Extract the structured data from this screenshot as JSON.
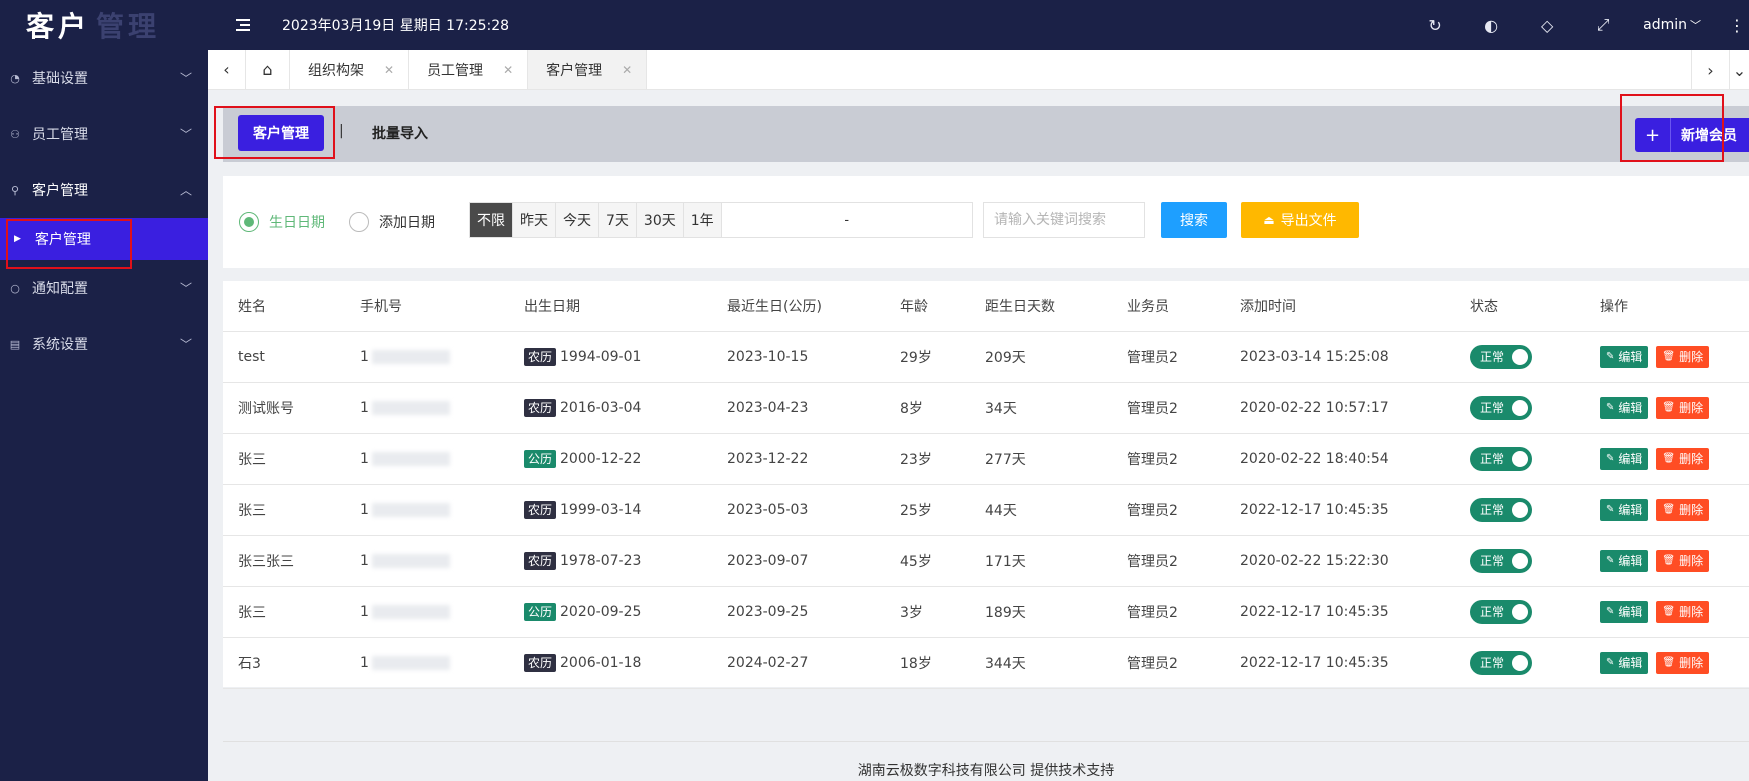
{
  "logo": {
    "part1": "客户",
    "part2": "管理"
  },
  "sidebar": {
    "items": [
      {
        "label": "基础设置",
        "icon": "gauge-icon"
      },
      {
        "label": "员工管理",
        "icon": "users-icon"
      },
      {
        "label": "客户管理",
        "icon": "user-icon"
      },
      {
        "label": "通知配置",
        "icon": "circle-icon"
      },
      {
        "label": "系统设置",
        "icon": "settings-icon"
      }
    ],
    "active_sub": "客户管理"
  },
  "header": {
    "datetime": "2023年03月19日 星期日 17:25:28",
    "user": "admin"
  },
  "tabs": [
    {
      "label": "组织构架"
    },
    {
      "label": "员工管理"
    },
    {
      "label": "客户管理"
    }
  ],
  "strip": {
    "active_btn": "客户管理",
    "separator": "|",
    "import_link": "批量导入",
    "add_member": "新增会员",
    "add_plus": "+"
  },
  "filter": {
    "radio_birthday": "生日日期",
    "radio_added": "添加日期",
    "ranges": [
      "不限",
      "昨天",
      "今天",
      "7天",
      "30天",
      "1年"
    ],
    "date_sep": "-",
    "keyword_placeholder": "请输入关键词搜索",
    "search": "搜索",
    "export": "导出文件"
  },
  "table": {
    "headers": [
      "姓名",
      "手机号",
      "出生日期",
      "最近生日(公历)",
      "年龄",
      "距生日天数",
      "业务员",
      "添加时间",
      "状态",
      "操作"
    ],
    "rows": [
      {
        "name": "test",
        "phone": "1",
        "cal": "农历",
        "birth": "1994-09-01",
        "next": "2023-10-15",
        "age": "29岁",
        "days": "209天",
        "sales": "管理员2",
        "added": "2023-03-14 15:25:08",
        "status": "正常"
      },
      {
        "name": "测试账号",
        "phone": "1",
        "cal": "农历",
        "birth": "2016-03-04",
        "next": "2023-04-23",
        "age": "8岁",
        "days": "34天",
        "sales": "管理员2",
        "added": "2020-02-22 10:57:17",
        "status": "正常"
      },
      {
        "name": "张三",
        "phone": "1",
        "cal": "公历",
        "birth": "2000-12-22",
        "next": "2023-12-22",
        "age": "23岁",
        "days": "277天",
        "sales": "管理员2",
        "added": "2020-02-22 18:40:54",
        "status": "正常"
      },
      {
        "name": "张三",
        "phone": "1",
        "cal": "农历",
        "birth": "1999-03-14",
        "next": "2023-05-03",
        "age": "25岁",
        "days": "44天",
        "sales": "管理员2",
        "added": "2022-12-17 10:45:35",
        "status": "正常"
      },
      {
        "name": "张三张三",
        "phone": "1",
        "cal": "农历",
        "birth": "1978-07-23",
        "next": "2023-09-07",
        "age": "45岁",
        "days": "171天",
        "sales": "管理员2",
        "added": "2020-02-22 15:22:30",
        "status": "正常"
      },
      {
        "name": "张三",
        "phone": "1",
        "cal": "公历",
        "birth": "2020-09-25",
        "next": "2023-09-25",
        "age": "3岁",
        "days": "189天",
        "sales": "管理员2",
        "added": "2022-12-17 10:45:35",
        "status": "正常"
      },
      {
        "name": "石3",
        "phone": "1",
        "cal": "农历",
        "birth": "2006-01-18",
        "next": "2024-02-27",
        "age": "18岁",
        "days": "344天",
        "sales": "管理员2",
        "added": "2022-12-17 10:45:35",
        "status": "正常"
      }
    ],
    "edit_label": "编辑",
    "delete_label": "删除"
  },
  "footer": "湖南云极数字科技有限公司 提供技术支持",
  "colors": {
    "sidebar_bg": "#1b2147",
    "accent": "#3a1fe0",
    "green": "#1a8a6b",
    "red": "#ff4d24",
    "blue": "#1e9fff",
    "orange": "#ffb800",
    "highlight": "#e0101a"
  }
}
